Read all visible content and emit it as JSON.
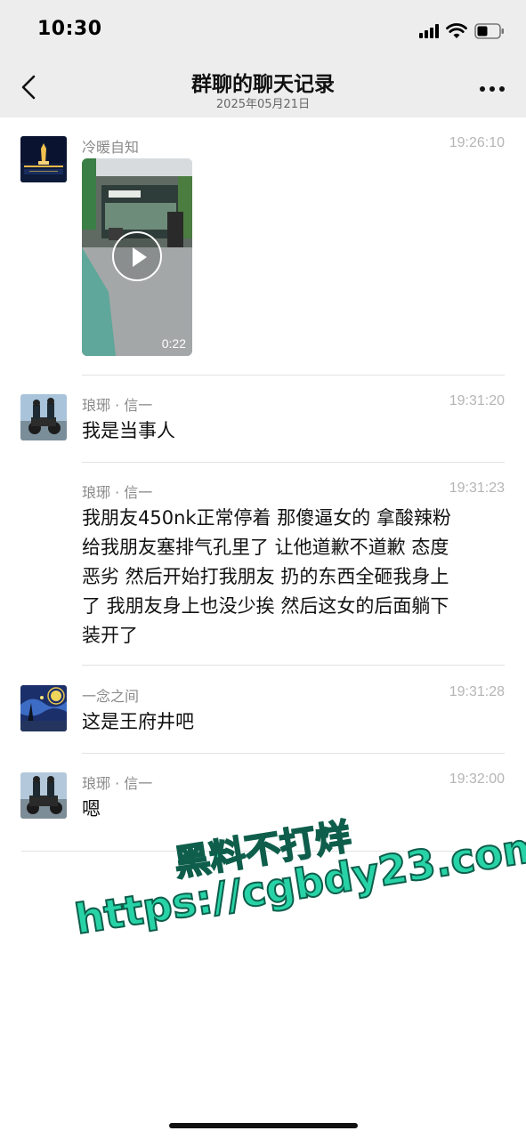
{
  "status_bar": {
    "time": "10:30"
  },
  "nav": {
    "title": "群聊的聊天记录",
    "date": "2025年05月21日"
  },
  "messages": [
    {
      "sender": "冷暖自知",
      "time": "19:26:10",
      "video_duration": "0:22"
    },
    {
      "sender": "琅琊 · 信一",
      "time": "19:31:20",
      "text": "我是当事人"
    },
    {
      "sender": "琅琊 · 信一",
      "time": "19:31:23",
      "lines": [
        "我朋友450nk正常停着  那傻逼女的 拿酸辣粉",
        "给我朋友塞排气孔里了 让他道歉不道歉 态度",
        "恶劣 然后开始打我朋友  扔的东西全砸我身上",
        "了  我朋友身上也没少挨 然后这女的后面躺下",
        "装开了"
      ]
    },
    {
      "sender": "一念之间",
      "time": "19:31:28",
      "text": "这是王府井吧"
    },
    {
      "sender": "琅琊 · 信一",
      "time": "19:32:00",
      "text": "嗯"
    }
  ],
  "watermark": {
    "line1": "黑料不打烊",
    "line2": "https://cgbdy23.com"
  },
  "colors": {
    "header_bg": "#ededed",
    "watermark": "#27d3a6"
  }
}
